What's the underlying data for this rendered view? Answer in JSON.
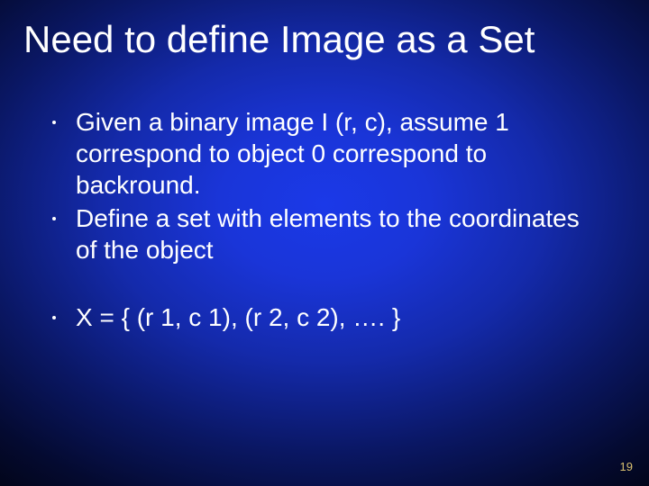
{
  "slide": {
    "title": "Need to define Image as a Set",
    "bullets": [
      "Given  a binary image I (r, c), assume 1 correspond to object 0 correspond to backround.",
      "Define  a set with elements to the coordinates of the object",
      "X = { (r 1, c 1), (r 2, c 2), …. }"
    ],
    "page_number": "19"
  }
}
